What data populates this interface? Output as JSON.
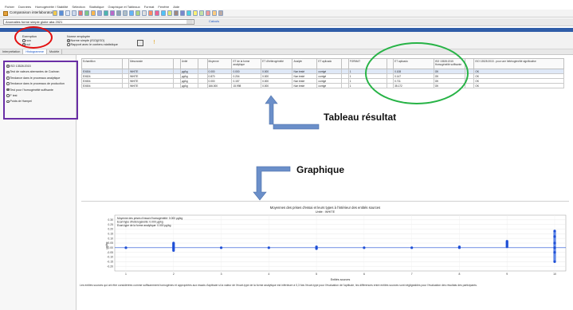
{
  "menu": [
    "Fichier",
    "Données",
    "Homogénéité / Stabilité",
    "Sélection",
    "Statistique",
    "Graphique et Tableaux",
    "Format",
    "Fenêtre",
    "Aide"
  ],
  "app_title": "Comparaison interlaboratoires",
  "study_select": "Anomalies forme simple globe aba 2021",
  "study_action": "Calculs",
  "options": {
    "group1_title": "Exemption",
    "group1_items": [
      {
        "label": "non",
        "selected": false
      },
      {
        "label": "oui",
        "selected": true
      }
    ],
    "group2_title": "Norme employée",
    "group2_items": [
      {
        "label": "Norme simple (ISO)(ISO)",
        "selected": true
      },
      {
        "label": "Rapport avec le contenu statistique",
        "selected": false
      }
    ]
  },
  "tabs": [
    "Interprétation",
    "Histogramme",
    "Modèle"
  ],
  "left_list": {
    "items": [
      {
        "label": "ISO 13528:2015",
        "selected": true
      },
      {
        "label": "Test de valeurs aberrantes de Cochran",
        "selected": false
      },
      {
        "label": "Tendance dans le processus analytique",
        "selected": false
      },
      {
        "label": "Tendance dans le processus de production",
        "selected": false
      },
      {
        "label": "Test pour l'homogénéité suffisante",
        "selected": true
      },
      {
        "label": "F test",
        "selected": false
      },
      {
        "label": "Poids de Hampel",
        "selected": false
      }
    ]
  },
  "results_table": {
    "headers": [
      "Echantillon",
      "",
      "Mesurande",
      "",
      "Unité",
      "",
      "Moyenne",
      "ET de la forme analytique",
      "ET d'hétérogénéité",
      "Analyte",
      "ET aplicado",
      "",
      "FORMAT",
      "",
      "ET aplicado",
      "ISO 13528:2015 Homogénéité suffisante",
      "",
      "ISO 13528:2015 - pour une hétérogénéité significative"
    ],
    "rows": [
      [
        "EX804",
        "",
        "WHITE",
        "",
        "µg/kg",
        "",
        "0.000",
        "0.000",
        "0.000",
        "Non testé",
        "corrigé",
        "",
        "1",
        "",
        "0.108",
        "OK",
        "",
        "OK"
      ],
      [
        "EX824",
        "",
        "WHITE",
        "",
        "µg/kg",
        "",
        "0.870",
        "0.204",
        "0.000",
        "Non testé",
        "corrigé",
        "",
        "1",
        "",
        "0.147",
        "OK",
        "",
        "OK"
      ],
      [
        "EX804",
        "",
        "WHITE",
        "",
        "µg/kg",
        "",
        "0.000",
        "0.157",
        "0.000",
        "Non testé",
        "corrigé",
        "",
        "1",
        "",
        "0.711",
        "OK",
        "",
        "OK"
      ],
      [
        "EX804",
        "",
        "WHITE",
        "",
        "µg/kg",
        "",
        "166.000",
        "15.998",
        "0.000",
        "Non testé",
        "corrigé",
        "",
        "1",
        "",
        "35.172",
        "OK",
        "",
        "OK"
      ]
    ]
  },
  "callouts": {
    "table": "Tableau résultat",
    "chart": "Graphique"
  },
  "chart_data": {
    "type": "scatter",
    "title": "Moyennes des prises d'essai et leurs types à l'intérieur des entités sources",
    "subtitle": "Unité : WHITE",
    "xlabel": "Entités sources",
    "ylabel": "µg/kg",
    "ylim": [
      -0.25,
      0.35
    ],
    "yticks": [
      0.3,
      0.25,
      0.2,
      0.15,
      0.1,
      0.05,
      0.0,
      -0.05,
      -0.1,
      -0.15,
      -0.2
    ],
    "legend_lines": [
      "Moyenne des prises d'essai d'homogénéité: 0.000 µg/kg",
      "Ecart-type d'hétérogénéité: 0.000 µg/kg",
      "Ecart-type de la forme analytique: 0.000 µg/kg"
    ],
    "categories": [
      "1",
      "2",
      "3",
      "4",
      "5",
      "6",
      "7",
      "8",
      "9",
      "10"
    ],
    "points": [
      {
        "x": "1",
        "values": [
          0.0
        ]
      },
      {
        "x": "2",
        "values": [
          -0.03,
          -0.01,
          0.01,
          0.03,
          0.05
        ]
      },
      {
        "x": "3",
        "values": [
          0.0
        ]
      },
      {
        "x": "4",
        "values": [
          0.0
        ]
      },
      {
        "x": "5",
        "values": [
          -0.01,
          0.01
        ]
      },
      {
        "x": "6",
        "values": [
          0.0
        ]
      },
      {
        "x": "7",
        "values": [
          0.0
        ]
      },
      {
        "x": "8",
        "values": [
          0.0,
          0.01
        ]
      },
      {
        "x": "9",
        "values": [
          0.01,
          0.03,
          0.05,
          0.07
        ]
      },
      {
        "x": "10",
        "values": [
          -0.15,
          -0.05,
          0.0,
          0.05,
          0.12,
          0.18
        ]
      }
    ],
    "mean_line": 0.0,
    "grid": true
  },
  "footnote": "Les entités sources qui ont être considérées comme suffisamment homogènes et appropriées aux essais d'aptitude si la valeur de l'écart-type de la forme analytique est inférieure à 0,3 fois l'écart-type pour l'évaluation de l'aptitude, les différences entre entités sources sont négligeables pour l'évaluation des résultats des participants.",
  "colors": {
    "accent": "#2f5da8",
    "point": "#1f4fd6",
    "red_mark": "#e31010",
    "green_mark": "#27b346",
    "purple_mark": "#6a2fa6",
    "arrow": "#6b8fc9"
  }
}
